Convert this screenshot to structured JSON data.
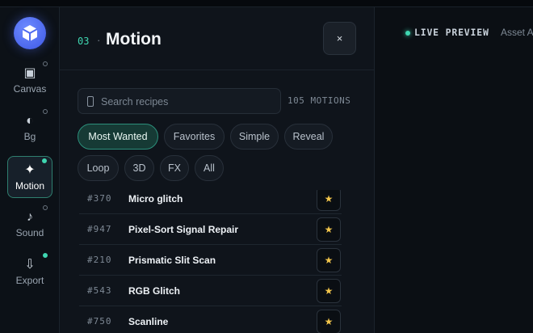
{
  "rail": {
    "items": [
      {
        "label": "Canvas",
        "icon": "▣"
      },
      {
        "label": "Bg",
        "icon": "◐"
      },
      {
        "label": "Motion",
        "icon": "✦"
      },
      {
        "label": "Sound",
        "icon": "♪"
      },
      {
        "label": "Export",
        "icon": "⇩"
      }
    ],
    "active": "Motion"
  },
  "panel": {
    "step": "03",
    "separator": "·",
    "title": "Motion",
    "close_label": "×",
    "search_placeholder": "Search recipes",
    "count": "105 MOTIONS",
    "chips": [
      "Most Wanted",
      "Favorites",
      "Simple",
      "Reveal",
      "Loop",
      "3D",
      "FX",
      "All"
    ],
    "active_chip": "Most Wanted",
    "rows": [
      {
        "id": "#370",
        "name": "Micro glitch",
        "star": "★"
      },
      {
        "id": "#947",
        "name": "Pixel-Sort Signal Repair",
        "star": "★"
      },
      {
        "id": "#210",
        "name": "Prismatic Slit Scan",
        "star": "★"
      },
      {
        "id": "#543",
        "name": "RGB Glitch",
        "star": "★"
      },
      {
        "id": "#750",
        "name": "Scanline",
        "star": "★"
      }
    ]
  },
  "preview": {
    "live_label": "LIVE PREVIEW",
    "asset_label": "Asset A"
  },
  "colors": {
    "accent": "#3fd6b1",
    "star": "#f2c54b",
    "logo": "#4f6bf0"
  }
}
